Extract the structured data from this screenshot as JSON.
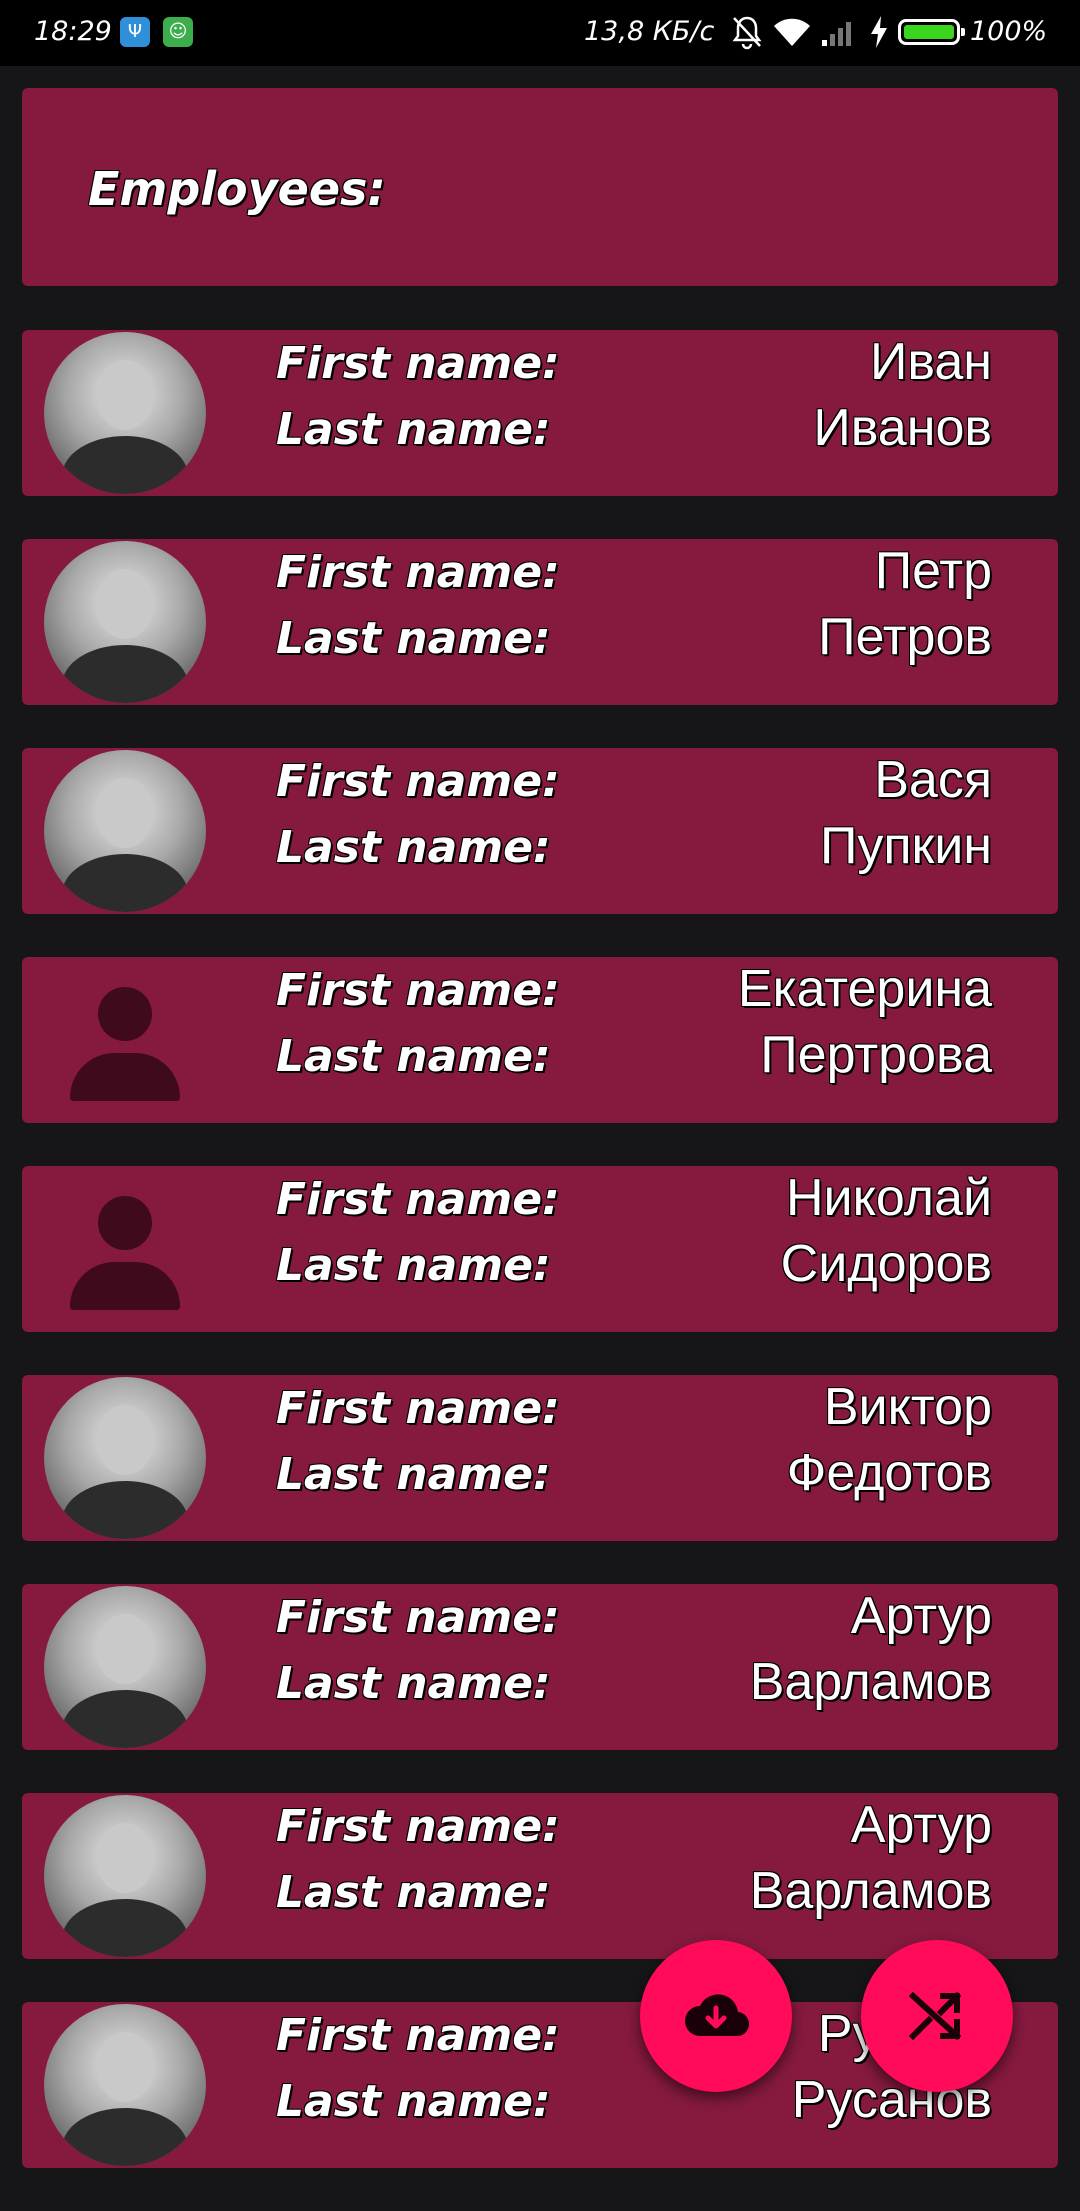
{
  "status_bar": {
    "time": "18:29",
    "app_icons": [
      "trident-app-icon",
      "cat-app-icon"
    ],
    "net_speed": "13,8 КБ/с",
    "icons": [
      "bell-muted-icon",
      "wifi-icon",
      "signal-icon",
      "charging-bolt-icon"
    ],
    "battery_level": 1.0,
    "battery_percent": "100%",
    "battery_color": "#3ad51f"
  },
  "header": {
    "title": "Employees:"
  },
  "labels": {
    "first_name": "First name:",
    "last_name": "Last name:"
  },
  "employees": [
    {
      "first_name": "Иван",
      "last_name": "Иванов",
      "avatar": "photo"
    },
    {
      "first_name": "Петр",
      "last_name": "Петров",
      "avatar": "photo"
    },
    {
      "first_name": "Вася",
      "last_name": "Пупкин",
      "avatar": "photo"
    },
    {
      "first_name": "Екатерина",
      "last_name": "Пертрова",
      "avatar": "placeholder"
    },
    {
      "first_name": "Николай",
      "last_name": "Сидоров",
      "avatar": "placeholder"
    },
    {
      "first_name": "Виктор",
      "last_name": "Федотов",
      "avatar": "photo"
    },
    {
      "first_name": "Артур",
      "last_name": "Варламов",
      "avatar": "photo"
    },
    {
      "first_name": "Артур",
      "last_name": "Варламов",
      "avatar": "photo"
    },
    {
      "first_name": "Руслан",
      "last_name": "Русанов",
      "avatar": "photo"
    }
  ],
  "fabs": {
    "download_icon": "cloud-download-icon",
    "shuffle_icon": "shuffle-icon"
  },
  "colors": {
    "background": "#161517",
    "card": "#861a3e",
    "fab": "#ff0b5a",
    "placeholder_avatar": "#3e0a1c"
  }
}
